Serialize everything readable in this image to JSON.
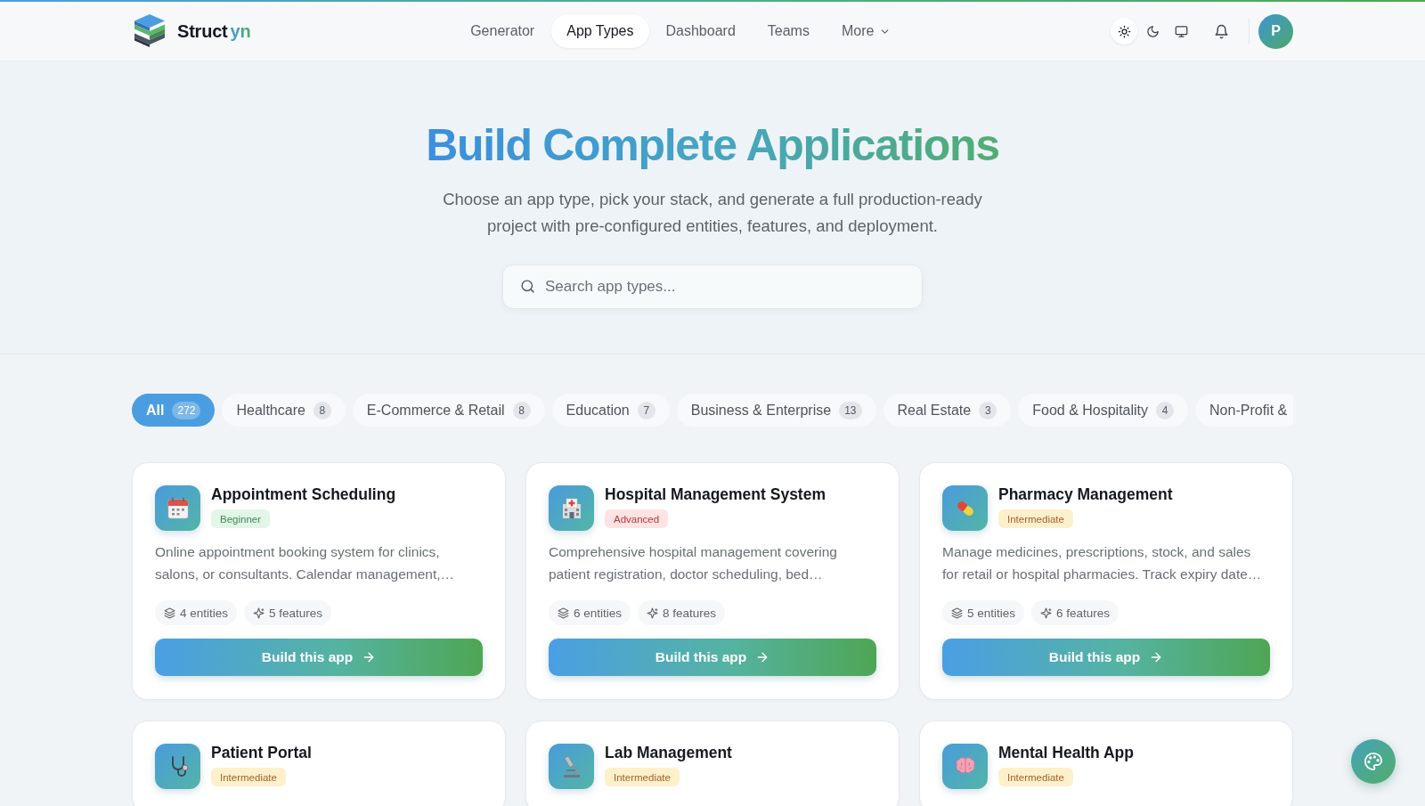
{
  "header": {
    "brand": {
      "name": "Struct",
      "accent": "yn"
    },
    "nav": [
      {
        "label": "Generator",
        "selected": false,
        "kind": "link"
      },
      {
        "label": "App Types",
        "selected": true,
        "kind": "link"
      },
      {
        "label": "Dashboard",
        "selected": false,
        "kind": "link"
      },
      {
        "label": "Teams",
        "selected": false,
        "kind": "link"
      },
      {
        "label": "More",
        "selected": false,
        "kind": "menu"
      }
    ],
    "theme_options": [
      {
        "selected": true
      },
      {
        "selected": false
      },
      {
        "selected": false
      }
    ],
    "avatar": "P"
  },
  "hero": {
    "title": "Build Complete Applications",
    "subtitle": "Choose an app type, pick your stack, and generate a full production-ready project with pre-configured entities, features, and deployment.",
    "search": {
      "placeholder": "Search app types..."
    }
  },
  "categories": [
    {
      "label": "All",
      "count": "272",
      "selected": true
    },
    {
      "label": "Healthcare",
      "count": "8",
      "selected": false
    },
    {
      "label": "E-Commerce & Retail",
      "count": "8",
      "selected": false
    },
    {
      "label": "Education",
      "count": "7",
      "selected": false
    },
    {
      "label": "Business & Enterprise",
      "count": "13",
      "selected": false
    },
    {
      "label": "Real Estate",
      "count": "3",
      "selected": false
    },
    {
      "label": "Food & Hospitality",
      "count": "4",
      "selected": false
    },
    {
      "label": "Non-Profit &",
      "selected": false
    }
  ],
  "apps": [
    {
      "title": "Appointment Scheduling",
      "badge": {
        "label": "Beginner",
        "kind": "beginner"
      },
      "description": "Online appointment booking system for clinics, salons, or consultants. Calendar management,…",
      "entities": "4 entities",
      "features": "5 features",
      "button": "Build this app"
    },
    {
      "title": "Hospital Management System",
      "badge": {
        "label": "Advanced",
        "kind": "advanced"
      },
      "description": "Comprehensive hospital management covering patient registration, doctor scheduling, bed…",
      "entities": "6 entities",
      "features": "8 features",
      "button": "Build this app"
    },
    {
      "title": "Pharmacy Management",
      "badge": {
        "label": "Intermediate",
        "kind": "intermediate"
      },
      "description": "Manage medicines, prescriptions, stock, and sales for retail or hospital pharmacies. Track expiry date…",
      "entities": "5 entities",
      "features": "6 features",
      "button": "Build this app"
    },
    {
      "title": "Patient Portal",
      "badge": {
        "label": "Intermediate",
        "kind": "intermediate"
      }
    },
    {
      "title": "Lab Management",
      "badge": {
        "label": "Intermediate",
        "kind": "intermediate"
      }
    },
    {
      "title": "Mental Health App",
      "badge": {
        "label": "Intermediate",
        "kind": "intermediate"
      }
    }
  ]
}
